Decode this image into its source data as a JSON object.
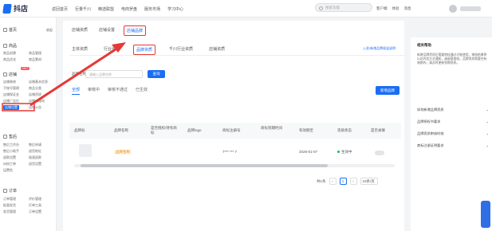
{
  "app": {
    "title": "抖店"
  },
  "top_nav": [
    "返回首页",
    "巨量千川",
    "精选联盟",
    "电商罗盘",
    "服务市场",
    "学习中心"
  ],
  "top_search": {
    "placeholder": "搜索功能"
  },
  "top_right": [
    "客户端",
    "体验",
    "消息"
  ],
  "sidebar": {
    "groups": [
      {
        "label": "首页",
        "right": "收起"
      },
      {
        "label": "商品"
      },
      {
        "label": "店铺"
      },
      {
        "label": "售后"
      },
      {
        "label": "订单"
      }
    ],
    "hot_badge": "HOT",
    "items": [
      "商品创建",
      "商品管理",
      "商品优化",
      "商品素材",
      "店铺装修",
      "店铺基本信息",
      "子账号管理",
      "商品分类",
      "店铺保证金",
      "店铺资质",
      "店铺广告位",
      "店铺设置",
      "店铺二维码",
      "店铺公告",
      "售后工作台",
      "售后申请",
      "售后小助手",
      "退货地址",
      "退款设置",
      "极速退款",
      "纠纷工单",
      "退货设置",
      "运费险",
      "订单管理",
      "评价管理",
      "批量发货",
      "打单工具",
      "发货管理",
      "订单设置"
    ],
    "active_item": "店铺设置"
  },
  "main": {
    "tabs1": [
      "店铺资质",
      "店铺设置",
      "店铺品牌"
    ],
    "tabs1_active": 2,
    "tabs2": [
      "主体资质",
      "行业资质",
      "品牌资质",
      "千川行业资质",
      "店铺资质"
    ],
    "tabs2_active": 2,
    "tabs2_link": "入驻/新增品牌权益说明",
    "filter": {
      "label": "品牌名称",
      "placeholder": "请输入品牌名称",
      "search": "查询"
    },
    "tabs3": [
      "全部",
      "审核中",
      "审核不通过",
      "已生效"
    ],
    "tabs3_active": 0,
    "add_button": "新增品牌",
    "table": {
      "headers": [
        "品牌标",
        "品牌名称",
        "是否授权/持有商标",
        "品牌logo",
        "商标注册号",
        "商标到期时间",
        "有效期至",
        "资质状态",
        "是否关联"
      ],
      "row": {
        "brand_name": "品牌名称",
        "reg_no": "7*** *** 7",
        "expire": "2026-01-07",
        "status": "生效中"
      }
    },
    "pagination": {
      "total": "共1条",
      "current": "1",
      "page_size": "10条/页"
    }
  },
  "right_panel": {
    "title": "相关帮助",
    "text": "新增品牌资质后需要审核通过才能使用，审核结果将以站内信方式通知，请留意查收。品牌资质需要在有效期内，请及时更新到期资质。",
    "items": [
      "如何新增品牌资质",
      "品牌授权书要求",
      "品牌资质审核时效",
      "商标注册证明要求"
    ]
  },
  "colors": {
    "accent": "#1b6ef3",
    "highlight_box": "#e53935",
    "active_status": "#22b35e"
  }
}
